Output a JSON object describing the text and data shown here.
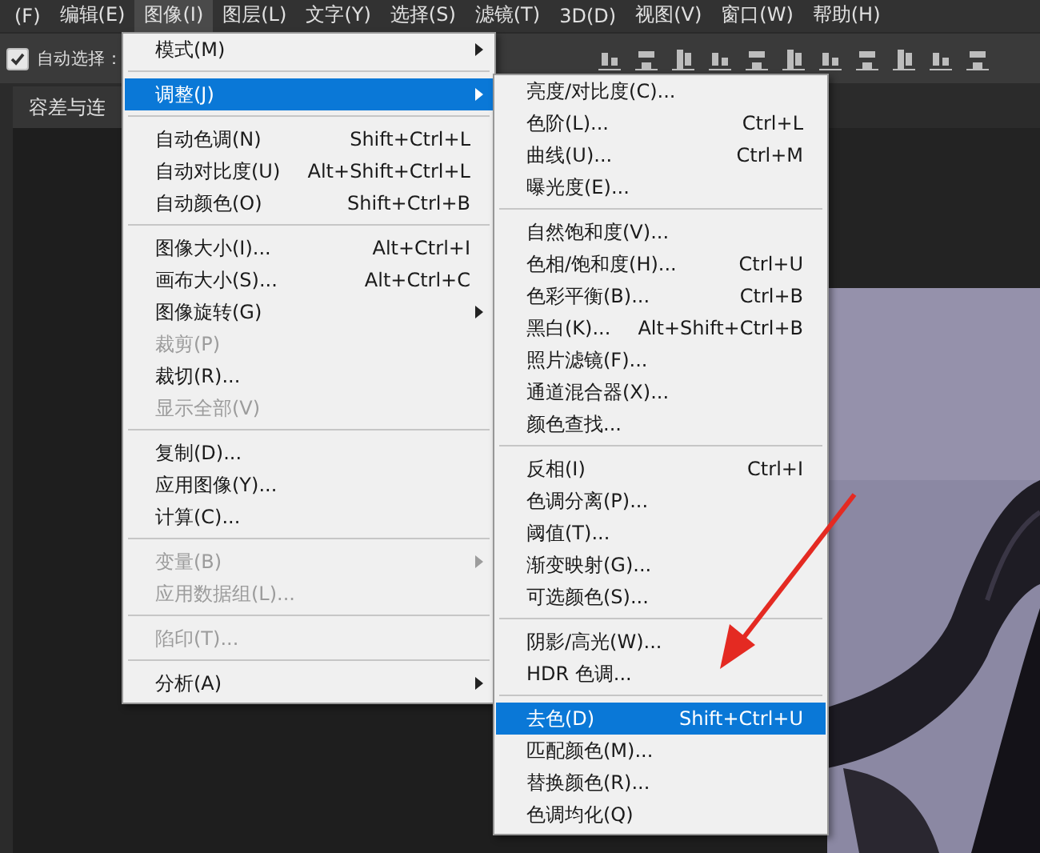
{
  "menubar": [
    {
      "label": "(F)",
      "selected": false
    },
    {
      "label": "编辑(E)",
      "selected": false
    },
    {
      "label": "图像(I)",
      "selected": true
    },
    {
      "label": "图层(L)",
      "selected": false
    },
    {
      "label": "文字(Y)",
      "selected": false
    },
    {
      "label": "选择(S)",
      "selected": false
    },
    {
      "label": "滤镜(T)",
      "selected": false
    },
    {
      "label": "3D(D)",
      "selected": false
    },
    {
      "label": "视图(V)",
      "selected": false
    },
    {
      "label": "窗口(W)",
      "selected": false
    },
    {
      "label": "帮助(H)",
      "selected": false
    }
  ],
  "options_bar": {
    "auto_select": {
      "label": "自动选择：",
      "checked": true
    }
  },
  "document_tab": {
    "label": "容差与连"
  },
  "image_menu": {
    "groups": [
      [
        {
          "label": "模式(M)",
          "submenu": true,
          "disabled": false,
          "selected": false
        }
      ],
      [
        {
          "label": "调整(J)",
          "submenu": true,
          "disabled": false,
          "selected": true
        }
      ],
      [
        {
          "label": "自动色调(N)",
          "shortcut": "Shift+Ctrl+L",
          "disabled": false,
          "selected": false
        },
        {
          "label": "自动对比度(U)",
          "shortcut": "Alt+Shift+Ctrl+L",
          "disabled": false,
          "selected": false
        },
        {
          "label": "自动颜色(O)",
          "shortcut": "Shift+Ctrl+B",
          "disabled": false,
          "selected": false
        }
      ],
      [
        {
          "label": "图像大小(I)...",
          "shortcut": "Alt+Ctrl+I",
          "disabled": false,
          "selected": false
        },
        {
          "label": "画布大小(S)...",
          "shortcut": "Alt+Ctrl+C",
          "disabled": false,
          "selected": false
        },
        {
          "label": "图像旋转(G)",
          "submenu": true,
          "disabled": false,
          "selected": false
        },
        {
          "label": "裁剪(P)",
          "disabled": true,
          "selected": false
        },
        {
          "label": "裁切(R)...",
          "disabled": false,
          "selected": false
        },
        {
          "label": "显示全部(V)",
          "disabled": true,
          "selected": false
        }
      ],
      [
        {
          "label": "复制(D)...",
          "disabled": false,
          "selected": false
        },
        {
          "label": "应用图像(Y)...",
          "disabled": false,
          "selected": false
        },
        {
          "label": "计算(C)...",
          "disabled": false,
          "selected": false
        }
      ],
      [
        {
          "label": "变量(B)",
          "submenu": true,
          "disabled": true,
          "selected": false
        },
        {
          "label": "应用数据组(L)...",
          "disabled": true,
          "selected": false
        }
      ],
      [
        {
          "label": "陷印(T)...",
          "disabled": true,
          "selected": false
        }
      ],
      [
        {
          "label": "分析(A)",
          "submenu": true,
          "disabled": false,
          "selected": false
        }
      ]
    ]
  },
  "adjust_submenu": {
    "groups": [
      [
        {
          "label": "亮度/对比度(C)...",
          "disabled": false,
          "selected": false
        },
        {
          "label": "色阶(L)...",
          "shortcut": "Ctrl+L",
          "disabled": false,
          "selected": false
        },
        {
          "label": "曲线(U)...",
          "shortcut": "Ctrl+M",
          "disabled": false,
          "selected": false
        },
        {
          "label": "曝光度(E)...",
          "disabled": false,
          "selected": false
        }
      ],
      [
        {
          "label": "自然饱和度(V)...",
          "disabled": false,
          "selected": false
        },
        {
          "label": "色相/饱和度(H)...",
          "shortcut": "Ctrl+U",
          "disabled": false,
          "selected": false
        },
        {
          "label": "色彩平衡(B)...",
          "shortcut": "Ctrl+B",
          "disabled": false,
          "selected": false
        },
        {
          "label": "黑白(K)...",
          "shortcut": "Alt+Shift+Ctrl+B",
          "disabled": false,
          "selected": false
        },
        {
          "label": "照片滤镜(F)...",
          "disabled": false,
          "selected": false
        },
        {
          "label": "通道混合器(X)...",
          "disabled": false,
          "selected": false
        },
        {
          "label": "颜色查找...",
          "disabled": false,
          "selected": false
        }
      ],
      [
        {
          "label": "反相(I)",
          "shortcut": "Ctrl+I",
          "disabled": false,
          "selected": false
        },
        {
          "label": "色调分离(P)...",
          "disabled": false,
          "selected": false
        },
        {
          "label": "阈值(T)...",
          "disabled": false,
          "selected": false
        },
        {
          "label": "渐变映射(G)...",
          "disabled": false,
          "selected": false
        },
        {
          "label": "可选颜色(S)...",
          "disabled": false,
          "selected": false
        }
      ],
      [
        {
          "label": "阴影/高光(W)...",
          "disabled": false,
          "selected": false
        },
        {
          "label": "HDR 色调...",
          "disabled": false,
          "selected": false
        }
      ],
      [
        {
          "label": "去色(D)",
          "shortcut": "Shift+Ctrl+U",
          "disabled": false,
          "selected": true
        },
        {
          "label": "匹配颜色(M)...",
          "disabled": false,
          "selected": false
        },
        {
          "label": "替换颜色(R)...",
          "disabled": false,
          "selected": false
        },
        {
          "label": "色调均化(Q)",
          "disabled": false,
          "selected": false
        }
      ]
    ]
  }
}
